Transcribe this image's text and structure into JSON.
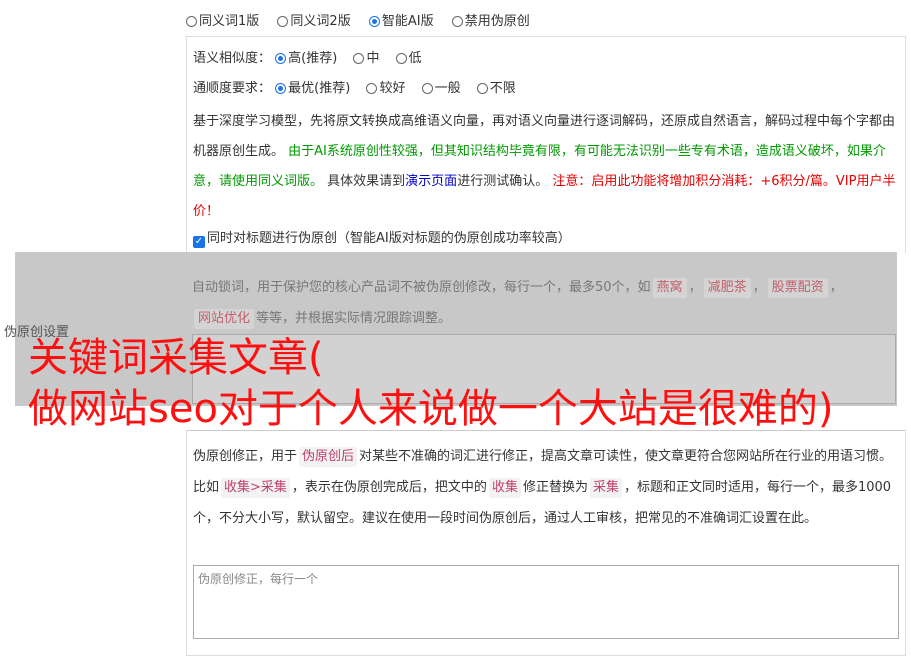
{
  "version_options": [
    {
      "label": "同义词1版",
      "selected": false
    },
    {
      "label": "同义词2版",
      "selected": false
    },
    {
      "label": "智能AI版",
      "selected": true
    },
    {
      "label": "禁用伪原创",
      "selected": false
    }
  ],
  "similarity": {
    "label": "语义相似度：",
    "options": [
      {
        "label": "高(推荐)",
        "selected": true
      },
      {
        "label": "中",
        "selected": false
      },
      {
        "label": "低",
        "selected": false
      }
    ]
  },
  "fluency": {
    "label": "通顺度要求：",
    "options": [
      {
        "label": "最优(推荐)",
        "selected": true
      },
      {
        "label": "较好",
        "selected": false
      },
      {
        "label": "一般",
        "selected": false
      },
      {
        "label": "不限",
        "selected": false
      }
    ]
  },
  "description": {
    "part1": "基于深度学习模型，先将原文转换成高维语义向量，再对语义向量进行逐词解码，还原成自然语言，解码过程中每个字都由机器原创生成。",
    "part2_green": "由于AI系统原创性较强，但其知识结构毕竟有限，有可能无法识别一些专有术语，造成语义破坏，如果介意，请使用同义词版。",
    "part3": "具体效果请到",
    "link": "演示页面",
    "part4": "进行测试确认。",
    "part5_red": "注意：启用此功能将增加积分消耗：+6积分/篇。VIP用户半价！"
  },
  "title_checkbox": {
    "label": "同时对标题进行伪原创（智能AI版对标题的伪原创成功率较高）",
    "checked": true
  },
  "section_label": "伪原创设置",
  "lock_words": {
    "desc_start": "自动锁词，用于保护您的核心产品词不被伪原创修改，每行一个，最多50个，如",
    "tags": [
      "燕窝",
      "减肥茶",
      "股票配资",
      "网站优化"
    ],
    "desc_end": "等等，并根据实际情况跟踪调整。",
    "sep": "，"
  },
  "overlay_title": {
    "line1": "关键词采集文章(",
    "line2": "做网站seo对于个人来说做一个大站是很难的)"
  },
  "fix": {
    "desc_a": "伪原创修正，用于",
    "tag_a": "伪原创后",
    "desc_b": "对某些不准确的词汇进行修正，提高文章可读性，使文章更符合您网站所在行业的用语习惯。比如",
    "tag_b": "收集>采集",
    "desc_c": "，表示在伪原创完成后，把文中的",
    "tag_c": "收集",
    "desc_d": "修正替换为",
    "tag_d": "采集",
    "desc_e": "，标题和正文同时适用，每行一个，最多1000个，不分大小写，默认留空。建议在使用一段时间伪原创后，通过人工审核，把常见的不准确词汇设置在此。",
    "placeholder": "伪原创修正，每行一个"
  }
}
